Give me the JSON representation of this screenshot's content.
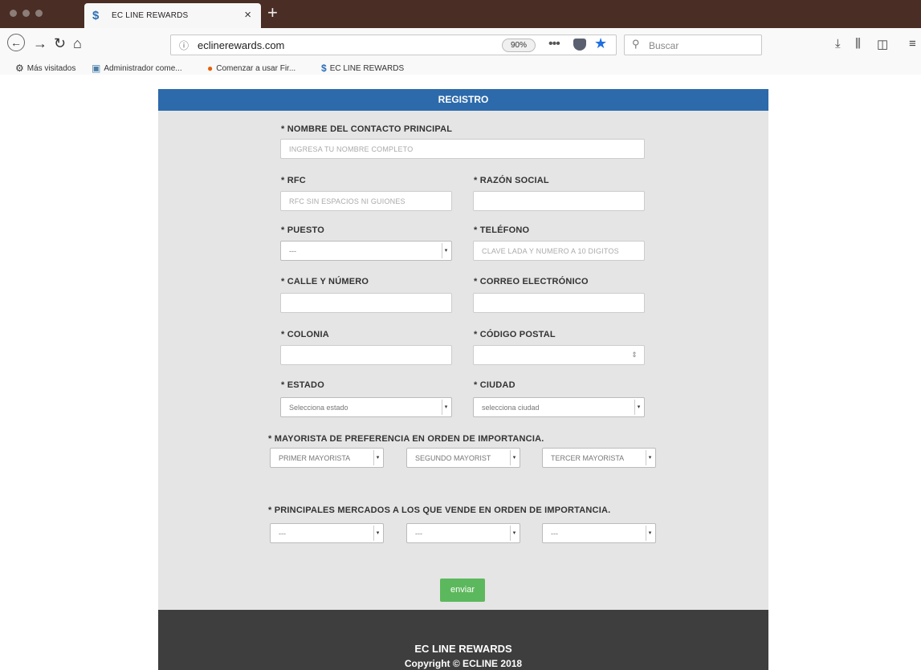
{
  "browser": {
    "tab_title": "EC LINE REWARDS",
    "url": "eclinerewards.com",
    "zoom": "90%",
    "search_placeholder": "Buscar",
    "bookmarks": [
      "Más visitados",
      "Administrador come...",
      "Comenzar a usar Fir...",
      "EC LINE REWARDS"
    ]
  },
  "form": {
    "title": "REGISTRO",
    "nombre": {
      "label": "* NOMBRE DEL CONTACTO PRINCIPAL",
      "placeholder": "INGRESA TU NOMBRE COMPLETO"
    },
    "rfc": {
      "label": "* RFC",
      "placeholder": "RFC SIN ESPACIOS NI GUIONES"
    },
    "razon": {
      "label": "* RAZÓN SOCIAL"
    },
    "puesto": {
      "label": "* PUESTO",
      "value": "---"
    },
    "telefono": {
      "label": "* TELÉFONO",
      "placeholder": "CLAVE LADA Y NUMERO A 10 DIGITOS"
    },
    "calle": {
      "label": "* CALLE Y NÚMERO"
    },
    "correo": {
      "label": "* CORREO ELECTRÓNICO"
    },
    "colonia": {
      "label": "* COLONIA"
    },
    "cp": {
      "label": "* CÓDIGO POSTAL"
    },
    "estado": {
      "label": "* ESTADO",
      "value": "Selecciona estado"
    },
    "ciudad": {
      "label": "* CIUDAD",
      "value": "selecciona ciudad"
    },
    "mayorista": {
      "label": "* MAYORISTA DE PREFERENCIA EN ORDEN DE IMPORTANCIA.",
      "options": [
        "PRIMER MAYORISTA",
        "SEGUNDO MAYORIST",
        "TERCER MAYORISTA"
      ]
    },
    "mercados": {
      "label": "* PRINCIPALES MERCADOS A LOS QUE VENDE EN ORDEN DE IMPORTANCIA.",
      "options": [
        "---",
        "---",
        "---"
      ]
    },
    "submit": "enviar"
  },
  "footer": {
    "brand": "EC LINE REWARDS",
    "copyright": "Copyright © ECLINE 2018"
  }
}
